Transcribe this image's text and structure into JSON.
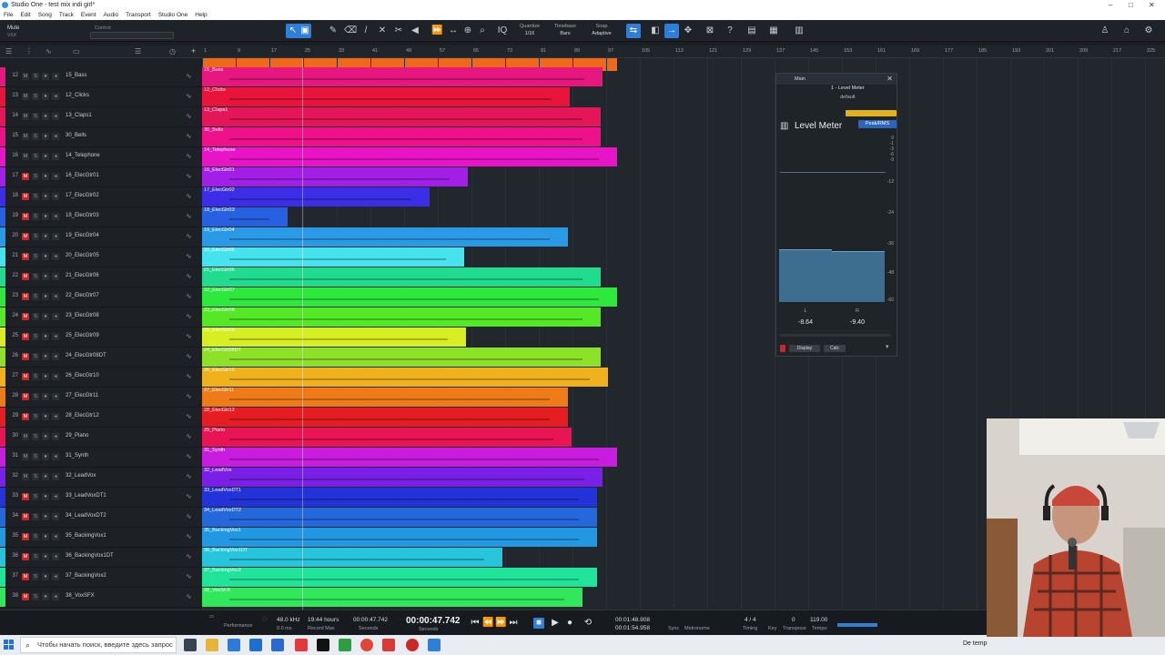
{
  "window": {
    "title": "Studio One - test mix indi girl*"
  },
  "menu": [
    "File",
    "Edit",
    "Song",
    "Track",
    "Event",
    "Audio",
    "Transport",
    "Studio One",
    "Help"
  ],
  "toolbar": {
    "mute_label": "Mute",
    "control_label": "Control",
    "mode_label": "VXX",
    "quantize_label": "Quantize",
    "quantize_value": "1/16",
    "timebase_label": "Timebase",
    "timebase_value": "Bars",
    "snap_label": "Snap",
    "snap_value": "Adaptive"
  },
  "ruler": [
    "1",
    "9",
    "17",
    "25",
    "33",
    "41",
    "49",
    "57",
    "65",
    "73",
    "81",
    "89",
    "97",
    "105",
    "113",
    "121",
    "129",
    "137",
    "145",
    "153",
    "161",
    "169",
    "177",
    "185",
    "193",
    "201",
    "209",
    "217",
    "225"
  ],
  "tracks": [
    {
      "num": "12",
      "name": "15_Bass",
      "clip": "15_Bass",
      "color": "#e6177f",
      "end": 440,
      "mred": false
    },
    {
      "num": "13",
      "name": "12_Clicks",
      "clip": "12_Clicks",
      "color": "#e8143c",
      "end": 404,
      "mred": false
    },
    {
      "num": "14",
      "name": "13_Claps1",
      "clip": "13_Claps1",
      "color": "#e5155a",
      "end": 438,
      "mred": false
    },
    {
      "num": "15",
      "name": "30_Bells",
      "clip": "30_Bells",
      "color": "#ee1189",
      "end": 438,
      "mred": false
    },
    {
      "num": "16",
      "name": "14_Telephone",
      "clip": "14_Telephone",
      "color": "#e815c6",
      "end": 456,
      "mred": false
    },
    {
      "num": "17",
      "name": "16_ElecGtr01",
      "clip": "16_ElecGtr01",
      "color": "#a21fe8",
      "end": 292,
      "mred": true
    },
    {
      "num": "18",
      "name": "17_ElecGtr02",
      "clip": "17_ElecGtr02",
      "color": "#3b2ee6",
      "end": 250,
      "mred": true
    },
    {
      "num": "19",
      "name": "18_ElecGtr03",
      "clip": "18_ElecGtr03",
      "color": "#2760e0",
      "end": 94,
      "mred": true
    },
    {
      "num": "20",
      "name": "19_ElecGtr04",
      "clip": "19_ElecGtr04",
      "color": "#2a9ae6",
      "end": 402,
      "mred": true
    },
    {
      "num": "21",
      "name": "20_ElecGtr05",
      "clip": "20_ElecGtr05",
      "color": "#45e3ee",
      "end": 288,
      "mred": true
    },
    {
      "num": "22",
      "name": "21_ElecGtr06",
      "clip": "21_ElecGtr06",
      "color": "#21dc8f",
      "end": 438,
      "mred": true
    },
    {
      "num": "23",
      "name": "22_ElecGtr07",
      "clip": "22_ElecGtr07",
      "color": "#2fe83e",
      "end": 456,
      "mred": true
    },
    {
      "num": "24",
      "name": "23_ElecGtr08",
      "clip": "23_ElecGtr08",
      "color": "#55e827",
      "end": 438,
      "mred": true
    },
    {
      "num": "25",
      "name": "25_ElecGtr09",
      "clip": "25_ElecGtr09",
      "color": "#d6ee22",
      "end": 290,
      "mred": true
    },
    {
      "num": "26",
      "name": "24_ElecGtr08DT",
      "clip": "24_ElecGtr08DT",
      "color": "#8de128",
      "end": 438,
      "mred": true
    },
    {
      "num": "27",
      "name": "26_ElecGtr10",
      "clip": "26_ElecGtr10",
      "color": "#f0b21c",
      "end": 446,
      "mred": true
    },
    {
      "num": "28",
      "name": "27_ElecGtr11",
      "clip": "27_ElecGtr11",
      "color": "#ee7b18",
      "end": 402,
      "mred": true
    },
    {
      "num": "29",
      "name": "28_ElecGtr12",
      "clip": "28_ElecGtr12",
      "color": "#e61e23",
      "end": 402,
      "mred": true
    },
    {
      "num": "30",
      "name": "29_Piano",
      "clip": "29_Piano",
      "color": "#e81454",
      "end": 406,
      "mred": false
    },
    {
      "num": "31",
      "name": "31_Synth",
      "clip": "31_Synth",
      "color": "#c81ddf",
      "end": 456,
      "mred": false
    },
    {
      "num": "32",
      "name": "32_LeadVox",
      "clip": "32_LeadVox",
      "color": "#7a20e6",
      "end": 440,
      "mred": false
    },
    {
      "num": "33",
      "name": "33_LeadVoxDT1",
      "clip": "33_LeadVoxDT1",
      "color": "#2234d8",
      "end": 434,
      "mred": true
    },
    {
      "num": "34",
      "name": "34_LeadVoxDT2",
      "clip": "34_LeadVoxDT2",
      "color": "#2468dc",
      "end": 434,
      "mred": true
    },
    {
      "num": "35",
      "name": "35_BackingVox1",
      "clip": "35_BackingVox1",
      "color": "#2398e2",
      "end": 434,
      "mred": true
    },
    {
      "num": "36",
      "name": "36_BackingVox1DT",
      "clip": "36_BackingVox1DT",
      "color": "#26c5dc",
      "end": 330,
      "mred": true
    },
    {
      "num": "37",
      "name": "37_BackingVox2",
      "clip": "37_BackingVox2",
      "color": "#20e49a",
      "end": 434,
      "mred": true
    },
    {
      "num": "38",
      "name": "38_VoxSFX",
      "clip": "38_VoxSFX",
      "color": "#31e85c",
      "end": 418,
      "mred": true
    }
  ],
  "level_meter": {
    "window_name": "Main",
    "device": "1 - Level Meter",
    "preset": "default",
    "title": "Level Meter",
    "mode": "Peak/RMS",
    "left_value": "-8.64",
    "right_value": "-9.40",
    "left_channel": "L",
    "right_channel": "R",
    "scale": [
      "0",
      "-1",
      "-3",
      "-6",
      "-9",
      "-12",
      "-24",
      "-36",
      "-48",
      "-60"
    ],
    "left_level": 0.33,
    "right_level": 0.32,
    "display_button": "Display",
    "calc_button": "Calc"
  },
  "transport": {
    "sample_rate": "48.0 kHz",
    "latency": "0.0 ms",
    "record_time": "19:44 hours",
    "record_max": "Record Max",
    "performance": "Performance",
    "seconds_small": "00:00:47.742",
    "seconds_label": "Seconds",
    "time_big": "00:00:47.742",
    "time_big_label": "Seconds",
    "loop_start": "00:01:48.908",
    "loop_end": "00:01:54.958",
    "sync_label": "Sync",
    "metronome_label": "Metronome",
    "signature": "4 / 4",
    "timing_label": "Timing",
    "key_label": "Key",
    "transpose": "0",
    "transpose_label": "Transpose",
    "tempo": "119.00",
    "tempo_label": "Tempo",
    "small_label": "Small"
  },
  "taskbar": {
    "search_placeholder": "Чтобы начать поиск, введите здесь запрос",
    "tray_text": "De temp"
  },
  "colors": {
    "accent": "#2f7fd6",
    "background": "#22272d",
    "meter_bar": "#3e6e8f"
  }
}
